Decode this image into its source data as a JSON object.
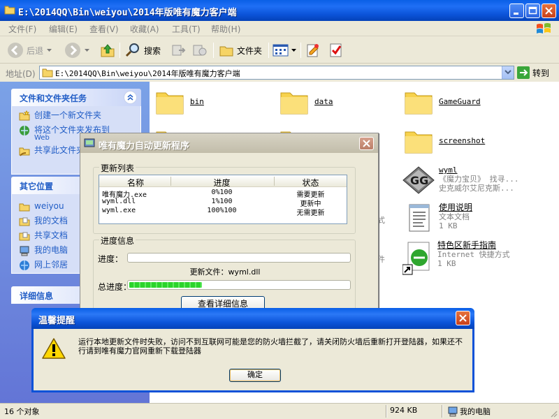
{
  "window": {
    "title": "E:\\2014QQ\\Bin\\weiyou\\2014年版唯有魔力客户端"
  },
  "menu": [
    "文件(F)",
    "编辑(E)",
    "查看(V)",
    "收藏(A)",
    "工具(T)",
    "帮助(H)"
  ],
  "toolbar": {
    "back": "后退",
    "search": "搜索",
    "folders": "文件夹"
  },
  "address": {
    "label": "地址(D)",
    "path": "E:\\2014QQ\\Bin\\weiyou\\2014年版唯有魔力客户端",
    "go": "转到"
  },
  "taskpane": {
    "file_tasks": {
      "title": "文件和文件夹任务",
      "items": [
        "创建一个新文件夹",
        "将这个文件夹发布到",
        "共享此文件夹"
      ],
      "publish_sub": "Web"
    },
    "other_places": {
      "title": "其它位置",
      "items": [
        "weiyou",
        "我的文档",
        "共享文档",
        "我的电脑",
        "网上邻居"
      ]
    },
    "details": {
      "title": "详细信息"
    }
  },
  "files": [
    {
      "name": "bin"
    },
    {
      "name": "data"
    },
    {
      "name": "GameGuard"
    },
    {
      "name": "screenshot"
    },
    {
      "name": "wyml",
      "line2": "《魔力宝贝》 找寻...",
      "line3": "史克威尔艾尼克斯..."
    },
    {
      "name": "使用说明",
      "line2": "文本文档",
      "line3": "1 KB"
    },
    {
      "name": "特色区新手指南",
      "line2": "Internet 快捷方式",
      "line3": "1 KB"
    }
  ],
  "file_fragments": [
    "式",
    "件"
  ],
  "status": {
    "objects": "16 个对象",
    "size": "924 KB",
    "location": "我的电脑"
  },
  "updater": {
    "title": "唯有魔力自动更新程序",
    "list_group": "更新列表",
    "columns": [
      "名称",
      "进度",
      "状态"
    ],
    "rows": [
      {
        "name": "唯有魔力.exe",
        "progress": "0%100",
        "status": "需要更新"
      },
      {
        "name": "wyml.dll",
        "progress": "1%100",
        "status": "更新中"
      },
      {
        "name": "wyml.exe",
        "progress": "100%100",
        "status": "无需更新"
      }
    ],
    "info_group": "进度信息",
    "progress_label": "进度：",
    "progress_value": 0,
    "current_file": "更新文件：wyml.dll",
    "total_label": "总进度：",
    "total_value": 0.33,
    "details_button": "查看详细信息"
  },
  "alert": {
    "title": "温馨提醒",
    "message": "运行本地更新文件时失败，访问不到互联网可能是您的防火墙拦截了，请关闭防火墙后重新打开登陆器，如果还不行请到唯有魔力官网重新下载登陆器",
    "ok": "确定"
  }
}
